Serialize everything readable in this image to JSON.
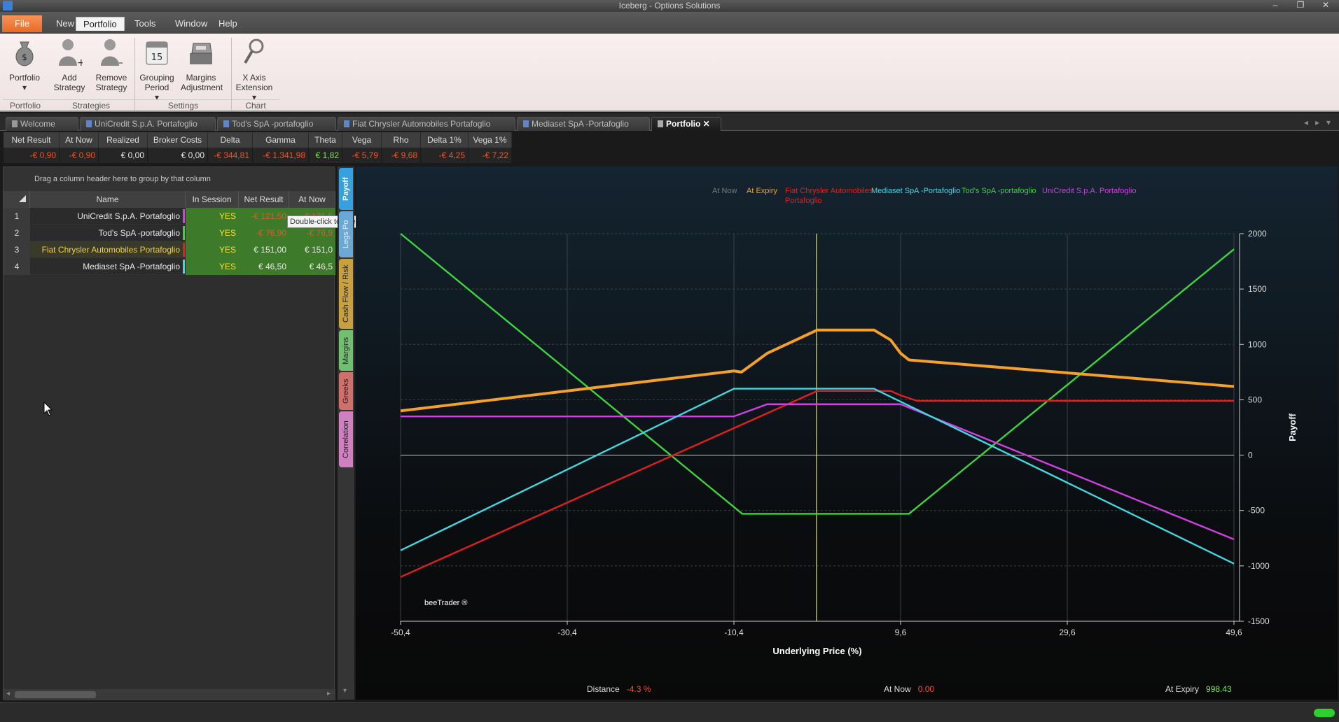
{
  "window": {
    "title": "Iceberg - Options Solutions"
  },
  "menu": [
    "File",
    "New",
    "Portfolio",
    "Tools",
    "Window",
    "Help"
  ],
  "ribbon": {
    "buttons": [
      {
        "label1": "Portfolio",
        "label2": ""
      },
      {
        "label1": "Add",
        "label2": "Strategy"
      },
      {
        "label1": "Remove",
        "label2": "Strategy"
      },
      {
        "label1": "Grouping",
        "label2": "Period"
      },
      {
        "label1": "Margins",
        "label2": "Adjustment"
      },
      {
        "label1": "X Axis",
        "label2": "Extension"
      }
    ],
    "groups": [
      "Portfolio",
      "Strategies",
      "Settings",
      "Chart"
    ]
  },
  "tabs": [
    "Welcome",
    "UniCredit S.p.A. Portafoglio",
    "Tod's SpA -portafoglio",
    "Fiat Chrysler Automobiles Portafoglio",
    "Mediaset SpA -Portafoglio",
    "Portfolio"
  ],
  "summary": {
    "headers": [
      "Net Result",
      "At Now",
      "Realized",
      "Broker Costs",
      "Delta",
      "Gamma",
      "Theta",
      "Vega",
      "Rho",
      "Delta 1%",
      "Vega 1%"
    ],
    "values": [
      "-€ 0,90",
      "-€ 0,90",
      "€ 0,00",
      "€ 0,00",
      "-€ 344,81",
      "-€ 1.341,98",
      "€ 1,82",
      "-€ 5,79",
      "-€ 9,68",
      "-€ 4,25",
      "-€ 7,22"
    ]
  },
  "grid": {
    "group_hint": "Drag a column header here to group by that column",
    "headers": [
      "Name",
      "In Session",
      "Net Result",
      "At Now"
    ],
    "rows": [
      {
        "n": "1",
        "name": "UniCredit S.p.A. Portafoglio",
        "session": "YES",
        "net": "-€ 121,50",
        "now": "-€ 121,5",
        "color": "#d040e0"
      },
      {
        "n": "2",
        "name": "Tod's SpA -portafoglio",
        "session": "YES",
        "net": "-€ 76,90",
        "now": "-€ 76,9",
        "color": "#3fd43f"
      },
      {
        "n": "3",
        "name": "Fiat Chrysler Automobiles Portafoglio",
        "session": "YES",
        "net": "€ 151,00",
        "now": "€ 151,0",
        "color": "#e02020"
      },
      {
        "n": "4",
        "name": "Mediaset SpA -Portafoglio",
        "session": "YES",
        "net": "€ 46,50",
        "now": "€ 46,5",
        "color": "#40d8e0"
      }
    ],
    "tooltip": "Double-click to open strategy"
  },
  "side_tabs": [
    "Payoff",
    "Legs Po",
    "Cash Flow / Risk",
    "Margins",
    "Greeks",
    "Correlation"
  ],
  "footer": {
    "distance_label": "Distance",
    "distance_value": "-4.3 %",
    "atnow_label": "At Now",
    "atnow_value": "0.00",
    "atexpiry_label": "At Expiry",
    "atexpiry_value": "998.43"
  },
  "watermark": "beeTrader ®",
  "colors": {
    "at_now": "#7a7a7a",
    "at_expiry": "#f4a02a",
    "fiat": "#e02020",
    "mediaset": "#40d8e0",
    "tods": "#3fd43f",
    "unicredit": "#d040e0",
    "cursor": "#e0e040"
  },
  "chart_data": {
    "type": "line",
    "xlabel": "Underlying Price (%)",
    "ylabel": "Payoff",
    "xlim": [
      -50.4,
      49.6
    ],
    "ylim": [
      -1500,
      2000
    ],
    "x_ticks": [
      "-50,4",
      "-30,4",
      "-10,4",
      "9,6",
      "29,6",
      "49,6"
    ],
    "y_ticks": [
      "2000",
      "1500",
      "1000",
      "500",
      "0",
      "-500",
      "-1000",
      "-1500"
    ],
    "cursor_x": -0.5,
    "legend_placement": "top",
    "series": [
      {
        "name": "At Now",
        "color": "#7a7a7a",
        "x": [],
        "y": []
      },
      {
        "name": "At Expiry",
        "color": "#f4a02a",
        "x": [
          -50.4,
          -10.4,
          -9.5,
          -6.4,
          -0.4,
          6.4,
          8.4,
          9.6,
          10.6,
          49.6
        ],
        "y": [
          400,
          760,
          750,
          920,
          1130,
          1130,
          1040,
          920,
          860,
          620
        ]
      },
      {
        "name": "Fiat Chrysler Automobiles Portafoglio",
        "color": "#e02020",
        "x": [
          -50.4,
          -0.4,
          8.4,
          9.6,
          11.6,
          49.6
        ],
        "y": [
          -1100,
          580,
          580,
          540,
          490,
          490
        ]
      },
      {
        "name": "Mediaset SpA -Portafoglio",
        "color": "#40d8e0",
        "x": [
          -50.4,
          -10.4,
          6.4,
          49.6
        ],
        "y": [
          -860,
          600,
          600,
          -980
        ]
      },
      {
        "name": "Tod's SpA -portafoglio",
        "color": "#3fd43f",
        "x": [
          -50.4,
          -9.4,
          10.6,
          49.6
        ],
        "y": [
          2000,
          -530,
          -530,
          1860
        ]
      },
      {
        "name": "UniCredit S.p.A. Portafoglio",
        "color": "#d040e0",
        "x": [
          -50.4,
          -10.4,
          -6.4,
          9.6,
          49.6
        ],
        "y": [
          350,
          350,
          460,
          460,
          -760
        ]
      }
    ]
  }
}
